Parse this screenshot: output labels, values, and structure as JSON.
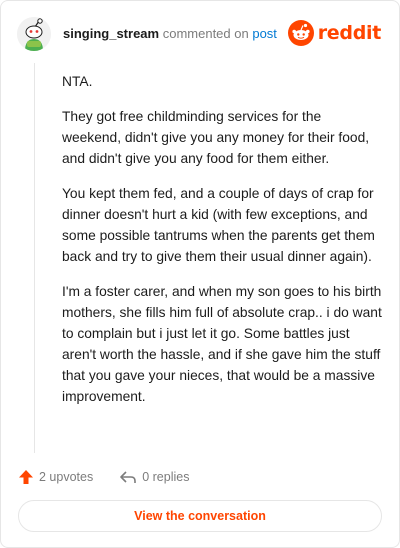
{
  "header": {
    "username": "singing_stream",
    "verb": "commented on",
    "post_link": "post",
    "brand": "reddit"
  },
  "comment": {
    "paragraphs": [
      "NTA.",
      "They got free childminding services for the weekend, didn't give you any money for their food, and didn't give you any food for them either.",
      "You kept them fed, and a couple of days of crap for dinner doesn't hurt a kid (with few exceptions, and some possible tantrums when the parents get them back and try to give them their usual dinner again).",
      "I'm a foster carer, and when my son goes to his birth mothers, she fills him full of absolute crap.. i do want to complain but i just let it go. Some battles just aren't worth the hassle, and if she gave him the stuff that you gave your nieces, that would be a massive improvement."
    ]
  },
  "actions": {
    "upvotes": "2 upvotes",
    "replies": "0 replies"
  },
  "cta": {
    "label": "View the conversation"
  },
  "colors": {
    "accent": "#ff4500",
    "link": "#0079d3",
    "muted": "#7c7c7c"
  },
  "icons": [
    "snoo-avatar-icon",
    "reddit-logo-icon",
    "upvote-arrow-icon",
    "reply-arrow-icon"
  ]
}
